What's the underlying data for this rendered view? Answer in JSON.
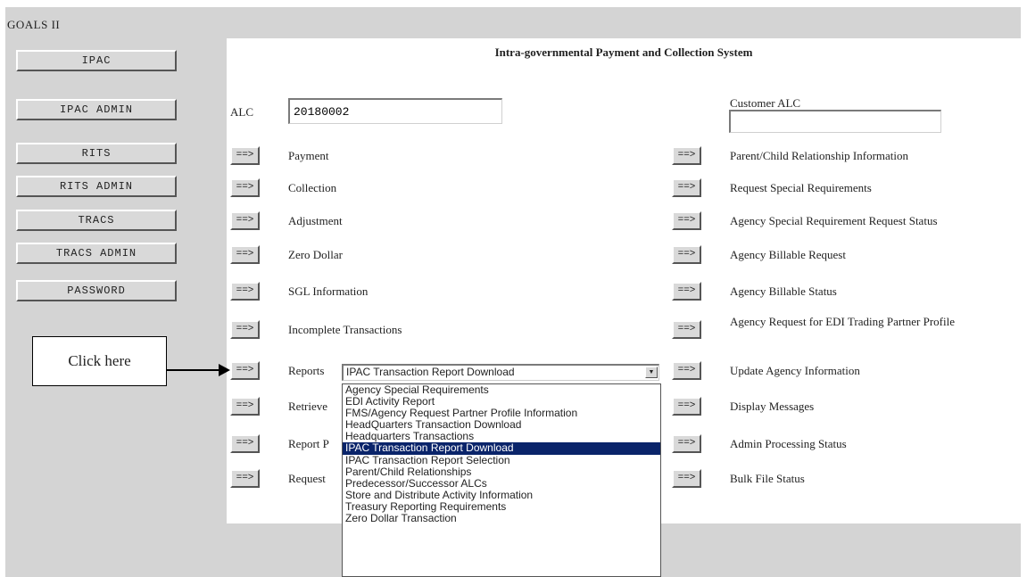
{
  "app_title": "GOALS II",
  "nav": [
    "IPAC",
    "IPAC ADMIN",
    "RITS",
    "RITS ADMIN",
    "TRACS",
    "TRACS ADMIN",
    "PASSWORD"
  ],
  "panel_title": "Intra-governmental Payment and Collection System",
  "alc_label": "ALC",
  "alc_value": "20180002",
  "customer_alc_label": "Customer ALC",
  "customer_alc_value": "",
  "arrow_label": "==>",
  "left_items": [
    "Payment",
    "Collection",
    "Adjustment",
    "Zero Dollar",
    "SGL Information",
    "Incomplete Transactions",
    "Reports",
    "Retrieve",
    "Report P",
    "Request"
  ],
  "right_items": [
    "Parent/Child Relationship Information",
    "Request Special Requirements",
    "Agency Special Requirement Request Status",
    "Agency Billable Request",
    "Agency Billable Status",
    "Agency Request for EDI Trading Partner Profile",
    "Update Agency Information",
    "Display Messages",
    "Admin Processing Status",
    "Bulk File Status"
  ],
  "reports_select_value": "IPAC Transaction Report Download",
  "reports_options": [
    "Agency Special Requirements",
    "EDI Activity Report",
    "FMS/Agency Request Partner Profile Information",
    "HeadQuarters Transaction Download",
    "Headquarters Transactions",
    "IPAC Transaction Report Download",
    "IPAC Transaction Report Selection",
    "Parent/Child Relationships",
    "Predecessor/Successor ALCs",
    "Store and Distribute Activity Information",
    "Treasury Reporting Requirements",
    "Zero Dollar Transaction"
  ],
  "selected_option_index": 5,
  "callout_text": "Click here"
}
